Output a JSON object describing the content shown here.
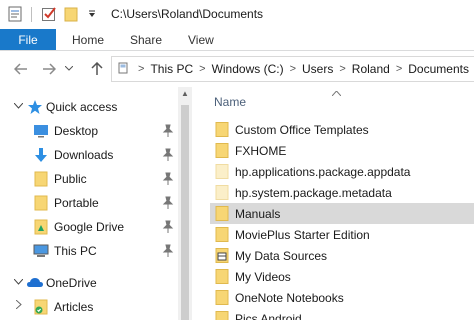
{
  "window": {
    "title": "C:\\Users\\Roland\\Documents"
  },
  "ribbon": {
    "tabs": [
      "File",
      "Home",
      "Share",
      "View"
    ]
  },
  "address": {
    "crumbs": [
      "This PC",
      "Windows (C:)",
      "Users",
      "Roland",
      "Documents"
    ]
  },
  "nav": {
    "quick_access": "Quick access",
    "items": [
      {
        "label": "Desktop",
        "icon": "desktop-icon"
      },
      {
        "label": "Downloads",
        "icon": "downloads-icon"
      },
      {
        "label": "Public",
        "icon": "folder-icon"
      },
      {
        "label": "Portable",
        "icon": "folder-icon"
      },
      {
        "label": "Google Drive",
        "icon": "google-drive-icon"
      },
      {
        "label": "This PC",
        "icon": "this-pc-icon"
      }
    ],
    "onedrive": "OneDrive",
    "articles": "Articles"
  },
  "content": {
    "column_name": "Name",
    "files": [
      {
        "name": "Custom Office Templates",
        "icon": "folder-icon",
        "selected": false
      },
      {
        "name": "FXHOME",
        "icon": "folder-icon",
        "selected": false
      },
      {
        "name": "hp.applications.package.appdata",
        "icon": "folder-faded-icon",
        "selected": false
      },
      {
        "name": "hp.system.package.metadata",
        "icon": "folder-faded-icon",
        "selected": false
      },
      {
        "name": "Manuals",
        "icon": "folder-icon",
        "selected": true
      },
      {
        "name": "MoviePlus Starter Edition",
        "icon": "folder-icon",
        "selected": false
      },
      {
        "name": "My Data Sources",
        "icon": "data-sources-folder-icon",
        "selected": false
      },
      {
        "name": "My Videos",
        "icon": "folder-icon",
        "selected": false
      },
      {
        "name": "OneNote Notebooks",
        "icon": "folder-icon",
        "selected": false
      },
      {
        "name": "Pics Android",
        "icon": "folder-icon",
        "selected": false
      }
    ]
  },
  "colors": {
    "accent": "#1979ca",
    "folder": "#f7d674",
    "selection": "#d9d9d9"
  }
}
